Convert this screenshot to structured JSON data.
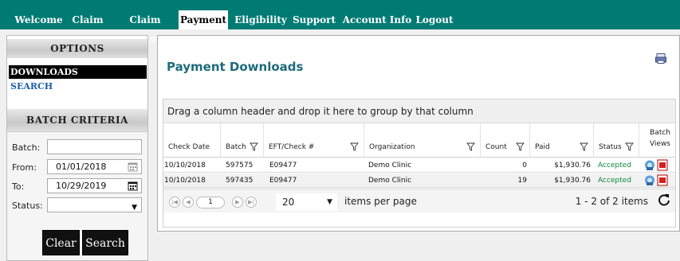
{
  "nav": {
    "tabs": [
      {
        "label": "Welcome"
      },
      {
        "label": "Claim"
      },
      {
        "label": "Claim Status"
      },
      {
        "label": "Payment"
      },
      {
        "label": "Eligibility"
      },
      {
        "label": "Support"
      },
      {
        "label": "Account Info"
      },
      {
        "label": "Logout"
      }
    ],
    "active": "Payment"
  },
  "sidebar": {
    "options_title": "OPTIONS",
    "items": [
      {
        "label": "DOWNLOADS"
      },
      {
        "label": "SEARCH"
      }
    ],
    "criteria_title": "BATCH CRITERIA",
    "fields": {
      "batch": {
        "label": "Batch:",
        "value": ""
      },
      "from": {
        "label": "From:",
        "value": "01/01/2018"
      },
      "to": {
        "label": "To:",
        "value": "10/29/2019"
      },
      "status": {
        "label": "Status:",
        "value": ""
      }
    },
    "clear_label": "Clear",
    "search_label": "Search"
  },
  "main": {
    "title": "Payment Downloads",
    "group_hint": "Drag a column header and drop it here to group by that column",
    "columns": [
      "Check Date",
      "Batch",
      "EFT/Check #",
      "Organization",
      "Count",
      "Paid",
      "Status",
      "Batch Views"
    ],
    "columns_split": {
      "batch_views_1": "Batch",
      "batch_views_2": "Views"
    },
    "rows": [
      {
        "check_date": "10/10/2018",
        "batch": "597575",
        "eft": "E09477",
        "organization": "Demo Clinic",
        "count": "0",
        "paid": "$1,930.76",
        "status": "Accepted"
      },
      {
        "check_date": "10/10/2018",
        "batch": "597435",
        "eft": "E09477",
        "organization": "Demo Clinic",
        "count": "19",
        "paid": "$1,930.76",
        "status": "Accepted"
      }
    ],
    "pager": {
      "page": "1",
      "page_size": "20",
      "per_page_label": "items per page",
      "summary": "1 - 2 of 2 items"
    }
  },
  "colors": {
    "nav": "#007b74",
    "title": "#1e6b7b",
    "accepted": "#0a8a3a",
    "link": "#1a5da8"
  }
}
